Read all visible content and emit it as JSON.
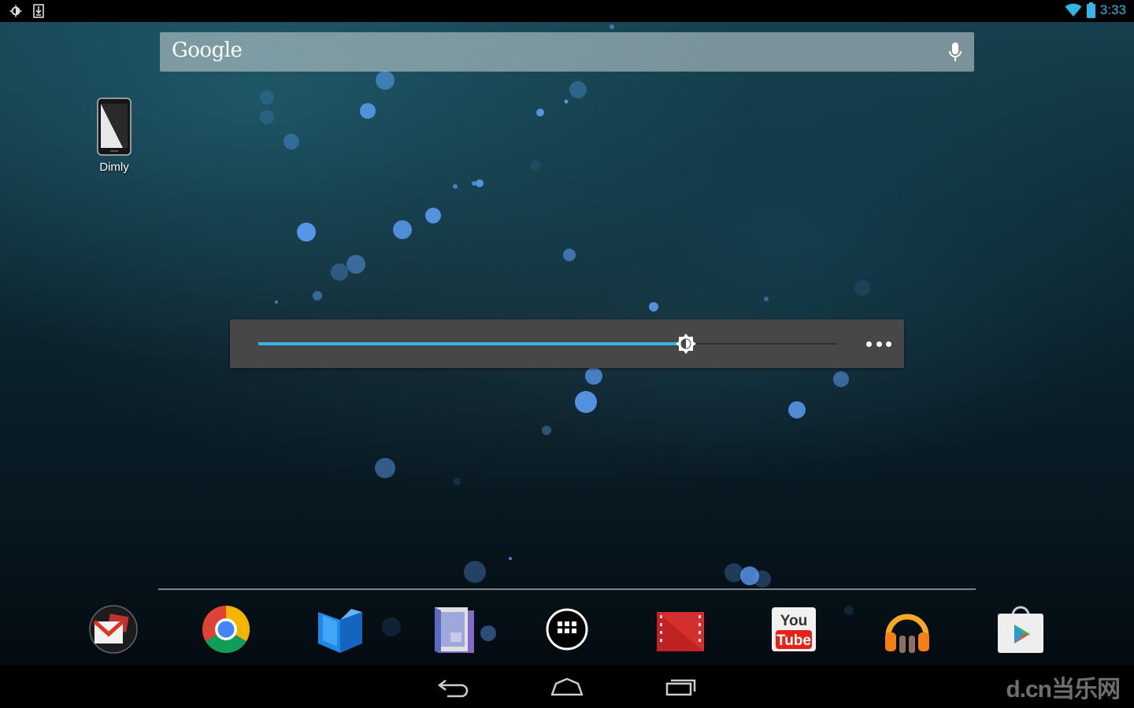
{
  "status_bar": {
    "time": "3:33",
    "icons_left": [
      "brightness-icon",
      "download-icon"
    ],
    "icons_right": [
      "wifi-icon",
      "battery-icon"
    ],
    "accent": "#33b5e5"
  },
  "search": {
    "label": "Google",
    "icon": "mic-icon"
  },
  "shortcut": {
    "label": "Dimly",
    "icon": "dimly-app-icon"
  },
  "brightness_widget": {
    "level": 0.74,
    "thumb_icon": "brightness-icon",
    "more_icon": "more-dots-icon"
  },
  "dock": {
    "items": [
      {
        "name": "gmail",
        "icon": "gmail-icon"
      },
      {
        "name": "chrome",
        "icon": "chrome-icon"
      },
      {
        "name": "play-books",
        "icon": "play-books-icon"
      },
      {
        "name": "play-magazines",
        "icon": "play-magazines-icon"
      },
      {
        "name": "app-drawer",
        "icon": "app-drawer-icon"
      },
      {
        "name": "play-movies",
        "icon": "play-movies-icon"
      },
      {
        "name": "youtube",
        "icon": "youtube-icon",
        "text_top": "You",
        "text_bottom": "Tube"
      },
      {
        "name": "play-music",
        "icon": "play-music-icon"
      },
      {
        "name": "play-store",
        "icon": "play-store-icon"
      }
    ]
  },
  "nav_bar": {
    "buttons": [
      "back-icon",
      "home-icon",
      "recents-icon"
    ]
  },
  "watermark": {
    "text": "d.cn当乐网"
  }
}
